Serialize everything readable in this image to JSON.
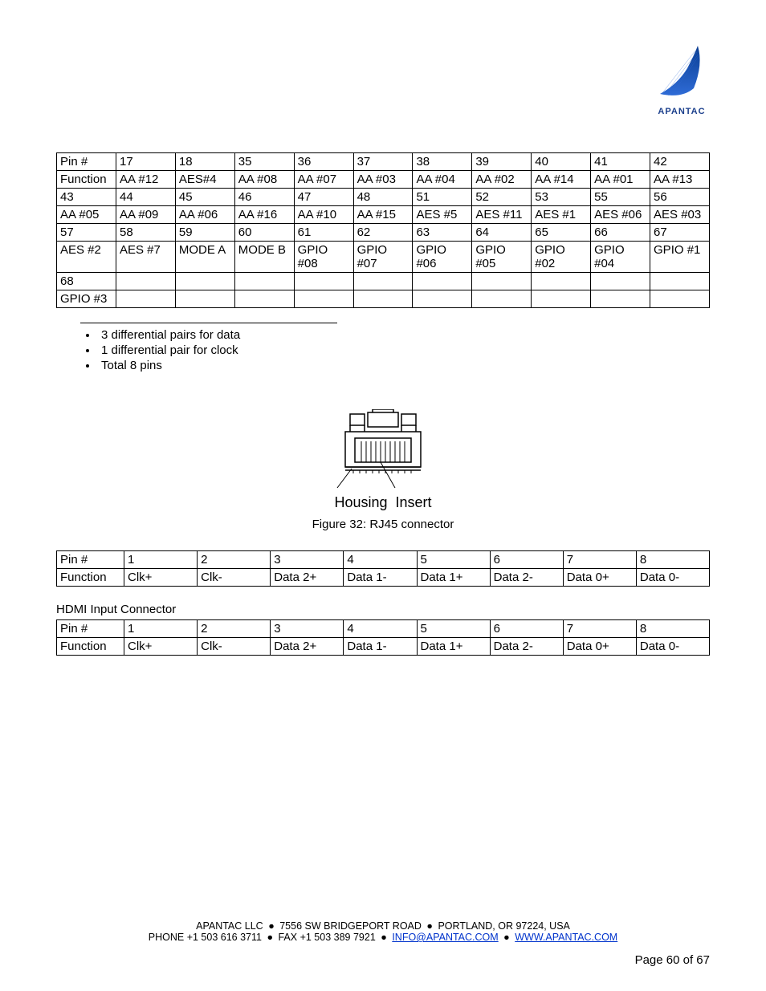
{
  "logo_text": "APANTAC",
  "table1": {
    "rows": [
      [
        "Pin #",
        "17",
        "18",
        "35",
        "36",
        "37",
        "38",
        "39",
        "40",
        "41",
        "42"
      ],
      [
        "Function",
        "AA #12",
        "AES#4",
        "AA #08",
        "AA #07",
        "AA #03",
        "AA #04",
        "AA #02",
        "AA #14",
        "AA #01",
        "AA #13"
      ],
      [
        "43",
        "44",
        "45",
        "46",
        "47",
        "48",
        "51",
        "52",
        "53",
        "55",
        "56"
      ],
      [
        "AA #05",
        "AA #09",
        "AA #06",
        "AA #16",
        "AA #10",
        "AA #15",
        "AES #5",
        "AES #11",
        "AES #1",
        "AES #06",
        "AES #03"
      ],
      [
        "57",
        "58",
        "59",
        "60",
        "61",
        "62",
        "63",
        "64",
        "65",
        "66",
        "67"
      ],
      [
        "AES #2",
        "AES #7",
        "MODE A",
        "MODE B",
        "GPIO #08",
        "GPIO #07",
        "GPIO #06",
        "GPIO #05",
        "GPIO #02",
        "GPIO #04",
        "GPIO #1"
      ],
      [
        "68",
        "",
        "",
        "",
        "",
        "",
        "",
        "",
        "",
        "",
        ""
      ],
      [
        "GPIO #3",
        "",
        "",
        "",
        "",
        "",
        "",
        "",
        "",
        "",
        ""
      ]
    ]
  },
  "bullets": [
    "3 differential pairs for data",
    "1 differential pair for clock",
    "Total 8 pins"
  ],
  "figure": {
    "label_left": "Housing",
    "label_right": "Insert",
    "caption": "Figure 32:  RJ45 connector"
  },
  "rj45_table": {
    "rows": [
      [
        "Pin #",
        "1",
        "2",
        "3",
        "4",
        "5",
        "6",
        "7",
        "8"
      ],
      [
        "Function",
        "Clk+",
        "Clk-",
        "Data 2+",
        "Data 1-",
        "Data 1+",
        "Data 2-",
        "Data 0+",
        "Data 0-"
      ]
    ]
  },
  "hdmi_section_title": "HDMI Input Connector",
  "hdmi_table": {
    "rows": [
      [
        "Pin #",
        "1",
        "2",
        "3",
        "4",
        "5",
        "6",
        "7",
        "8"
      ],
      [
        "Function",
        "Clk+",
        "Clk-",
        "Data 2+",
        "Data 1-",
        "Data 1+",
        "Data 2-",
        "Data 0+",
        "Data 0-"
      ]
    ]
  },
  "footer": {
    "company": "APANTAC LLC",
    "address": "7556 SW BRIDGEPORT ROAD",
    "city": "PORTLAND, OR 97224, USA",
    "phone": "PHONE +1 503 616 3711",
    "fax": "FAX +1 503 389 7921",
    "email": "INFO@APANTAC.COM",
    "web": "WWW.APANTAC.COM"
  },
  "page_number": "Page 60 of 67"
}
